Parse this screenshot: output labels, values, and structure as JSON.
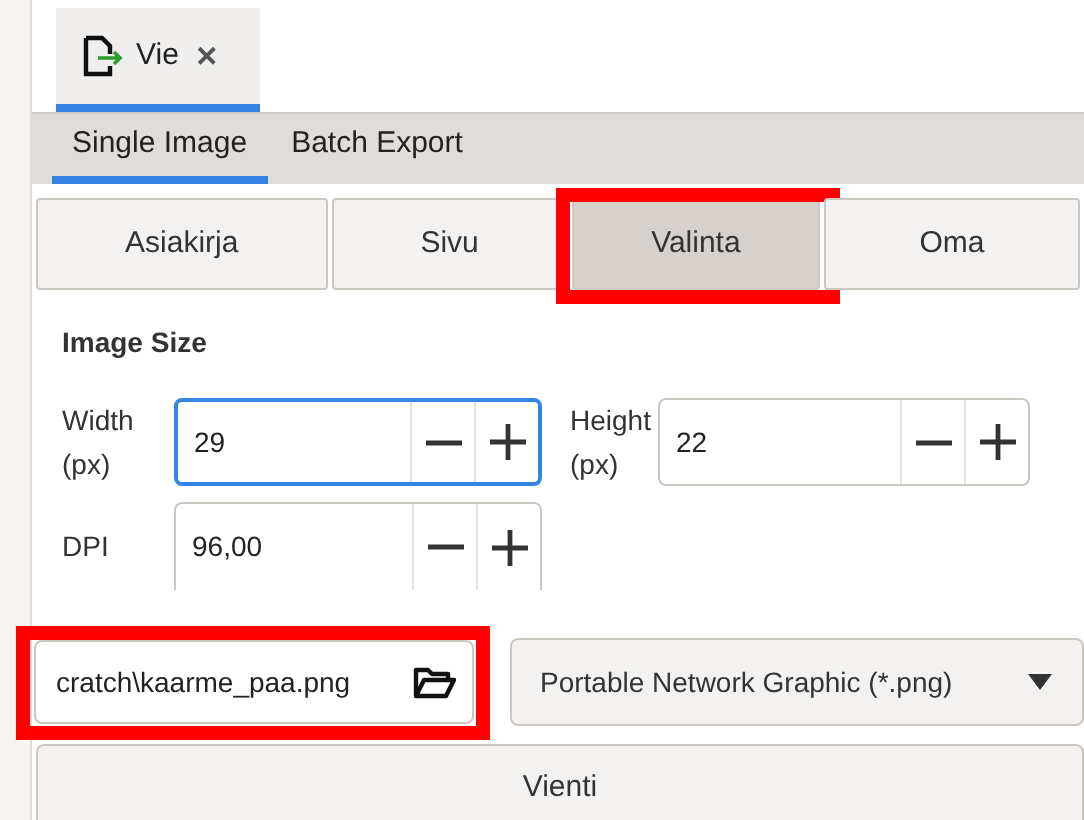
{
  "document_tabs": [
    {
      "label": "Vie",
      "close": "✕",
      "selected": true
    }
  ],
  "sub_tabs": [
    {
      "label": "Single Image",
      "selected": true
    },
    {
      "label": "Batch Export",
      "selected": false
    }
  ],
  "area_buttons": [
    {
      "label": "Asiakirja",
      "selected": false,
      "highlighted": false
    },
    {
      "label": "Sivu",
      "selected": false,
      "highlighted": false
    },
    {
      "label": "Valinta",
      "selected": true,
      "highlighted": true
    },
    {
      "label": "Oma",
      "selected": false,
      "highlighted": false
    }
  ],
  "image_size": {
    "title": "Image Size",
    "fields": [
      {
        "label": "Width\n(px)",
        "value": "29",
        "focused": true
      },
      {
        "label": "Height\n(px)",
        "value": "22",
        "focused": false
      },
      {
        "label": "DPI",
        "value": "96,00",
        "focused": false
      }
    ]
  },
  "file": {
    "value": "cratch\\kaarme_paa.png",
    "highlighted": true
  },
  "format": {
    "value": "Portable Network Graphic (*.png)"
  },
  "export_button": {
    "label": "Vienti"
  }
}
